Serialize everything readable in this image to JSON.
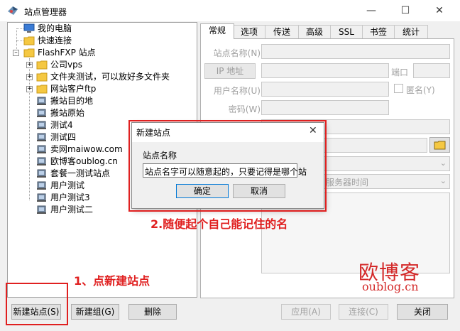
{
  "window": {
    "title": "站点管理器"
  },
  "tree": {
    "items": [
      {
        "label": "我的电脑",
        "icon": "computer-icon"
      },
      {
        "label": "快速连接",
        "icon": "folder-icon"
      },
      {
        "label": "FlashFXP 站点",
        "icon": "folder-icon"
      },
      {
        "label": "公司vps",
        "icon": "folder-icon"
      },
      {
        "label": "文件夹测试，可以放好多文件夹",
        "icon": "folder-icon"
      },
      {
        "label": "网站客户ftp",
        "icon": "folder-icon"
      },
      {
        "label": "搬站目的地",
        "icon": "server-icon"
      },
      {
        "label": "搬站原始",
        "icon": "server-icon"
      },
      {
        "label": "测试4",
        "icon": "server-icon"
      },
      {
        "label": "测试四",
        "icon": "server-icon"
      },
      {
        "label": "卖网maiwow.com",
        "icon": "server-icon"
      },
      {
        "label": "欧博客oublog.cn",
        "icon": "server-icon"
      },
      {
        "label": "套餐一测试站点",
        "icon": "server-icon"
      },
      {
        "label": "用户测试",
        "icon": "server-icon"
      },
      {
        "label": "用户测试3",
        "icon": "server-icon"
      },
      {
        "label": "用户测试二",
        "icon": "server-icon"
      }
    ]
  },
  "tabs": [
    "常规",
    "选项",
    "传送",
    "高级",
    "SSL",
    "书签",
    "统计"
  ],
  "form": {
    "site_name_label": "站点名称(N)",
    "ip_button": "IP 地址",
    "port_label": "端口",
    "username_label": "用户名称(U)",
    "anonymous_label": "匿名(Y)",
    "password_label": "密码(W)",
    "time_option": "服务器时间"
  },
  "buttons": {
    "new_site": "新建站点(S)",
    "new_group": "新建组(G)",
    "delete": "删除",
    "apply": "应用(A)",
    "connect": "连接(C)",
    "close": "关闭"
  },
  "dialog": {
    "title": "新建站点",
    "field_label": "站点名称",
    "field_value": "站点名字可以随意起的，只要记得是哪个站",
    "ok": "确定",
    "cancel": "取消"
  },
  "annotations": {
    "step1": "1、点新建站点",
    "step2": "2.随便起个自己能记住的名"
  },
  "watermark": {
    "title": "欧博客",
    "url": "oublog.cn"
  },
  "colors": {
    "highlight": "#e02020",
    "folder": "#f5c842",
    "computer": "#3a7bd5"
  }
}
